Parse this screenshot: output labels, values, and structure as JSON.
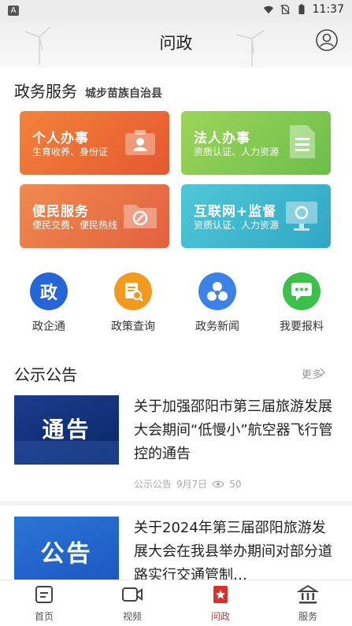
{
  "status_bar": {
    "time": "11:37",
    "icons": [
      "a-notification-icon",
      "wifi-icon",
      "no-sim-icon",
      "battery-icon"
    ]
  },
  "header": {
    "title": "问政",
    "icons": [
      "avatar-icon"
    ]
  },
  "services": {
    "title": "政务服务",
    "region": "城步苗族自治县",
    "cards": [
      {
        "title": "个人办事",
        "desc": "生育收养、身份证",
        "icon": "person-id-icon"
      },
      {
        "title": "法人办事",
        "desc": "资质认证、人力资源",
        "icon": "document-icon"
      },
      {
        "title": "便民服务",
        "desc": "便民交费、便民热线",
        "icon": "folder-icon"
      },
      {
        "title": "互联网+监督",
        "desc": "资质认证、人力资源",
        "icon": "monitor-icon"
      }
    ]
  },
  "quick_links": [
    {
      "label": "政企通",
      "icon": "zheng-badge-icon",
      "glyph": "政"
    },
    {
      "label": "政策查询",
      "icon": "policy-search-icon"
    },
    {
      "label": "政务新闻",
      "icon": "news-circles-icon"
    },
    {
      "label": "我要报料",
      "icon": "chat-bubble-icon"
    }
  ],
  "notices": {
    "title": "公示公告",
    "more": "更多",
    "items": [
      {
        "thumb_text": "通告",
        "title": "关于加强邵阳市第三届旅游发展大会期间“低慢小”航空器飞行管控的通告",
        "category": "公示公告",
        "date": "9月7日",
        "views": "50"
      },
      {
        "thumb_text": "公告",
        "title": "关于2024年第三届邵阳旅游发展大会在我县举办期间对部分道路实行交通管制…",
        "category": "",
        "date": "",
        "views": ""
      }
    ]
  },
  "tabbar": [
    {
      "label": "首页",
      "icon": "home-icon"
    },
    {
      "label": "视频",
      "icon": "video-icon"
    },
    {
      "label": "问政",
      "icon": "wenzheng-star-icon",
      "active": true
    },
    {
      "label": "服务",
      "icon": "government-building-icon"
    }
  ],
  "colors": {
    "accent": "#d9322a",
    "card1": "#ec6a35",
    "card2": "#84c953",
    "card3": "#e9744a",
    "card4": "#3db8cf"
  }
}
